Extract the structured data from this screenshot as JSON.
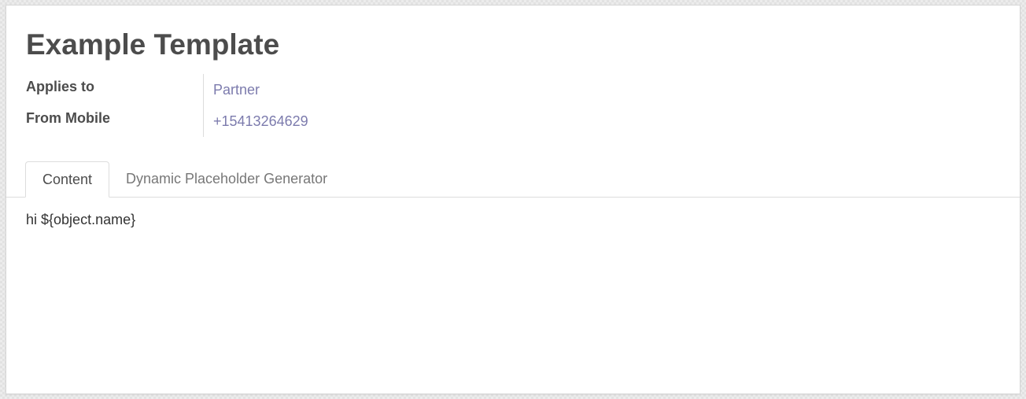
{
  "record": {
    "title": "Example Template"
  },
  "fields": [
    {
      "label": "Applies to",
      "value": "Partner"
    },
    {
      "label": "From Mobile",
      "value": "+15413264629"
    }
  ],
  "tabs": [
    {
      "label": "Content",
      "active": true
    },
    {
      "label": "Dynamic Placeholder Generator",
      "active": false
    }
  ],
  "content": {
    "body_text": "hi ${object.name}"
  },
  "colors": {
    "link": "#7c7bad",
    "text": "#4c4c4c",
    "border": "#dddddd"
  }
}
